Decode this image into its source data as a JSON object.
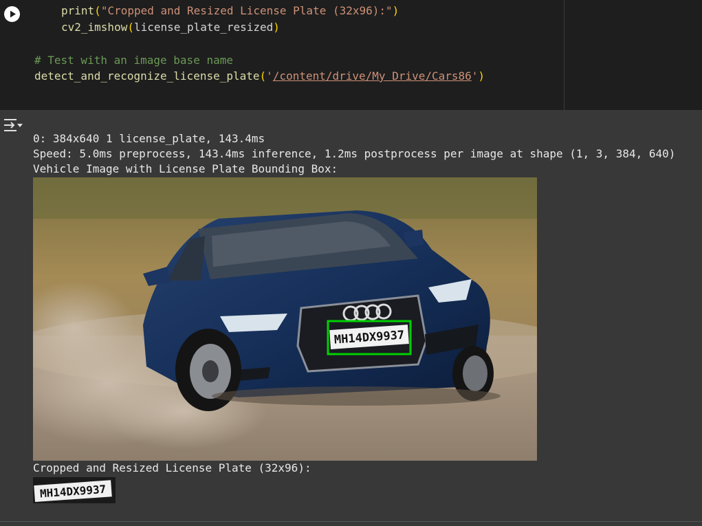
{
  "code": {
    "line1_func": "print",
    "line1_open": "(",
    "line1_str": "\"Cropped and Resized License Plate (32x96):\"",
    "line1_close": ")",
    "line2_func": "cv2_imshow",
    "line2_open": "(",
    "line2_arg": "license_plate_resized",
    "line2_close": ")",
    "comment": "# Test with an image base name",
    "call_func": "detect_and_recognize_license_plate",
    "call_open": "(",
    "call_q1": "'",
    "call_path": "/content/drive/My Drive/Cars86",
    "call_q2": "'",
    "call_close": ")"
  },
  "output": {
    "line1": "0: 384x640 1 license_plate, 143.4ms",
    "line2": "Speed: 5.0ms preprocess, 143.4ms inference, 1.2ms postprocess per image at shape (1, 3, 384, 640)",
    "line3": "Vehicle Image with License Plate Bounding Box:",
    "line4": "Cropped and Resized License Plate (32x96):",
    "plate_text": "MH14DX9937"
  },
  "colors": {
    "code_bg": "#1e1e1e",
    "output_bg": "#383838",
    "string": "#ce9178",
    "comment": "#6a9955",
    "function": "#dcdcaa",
    "bbox": "#00d000"
  },
  "icons": {
    "run": "play-circle-icon",
    "output_toggle": "output-collapse-icon"
  }
}
